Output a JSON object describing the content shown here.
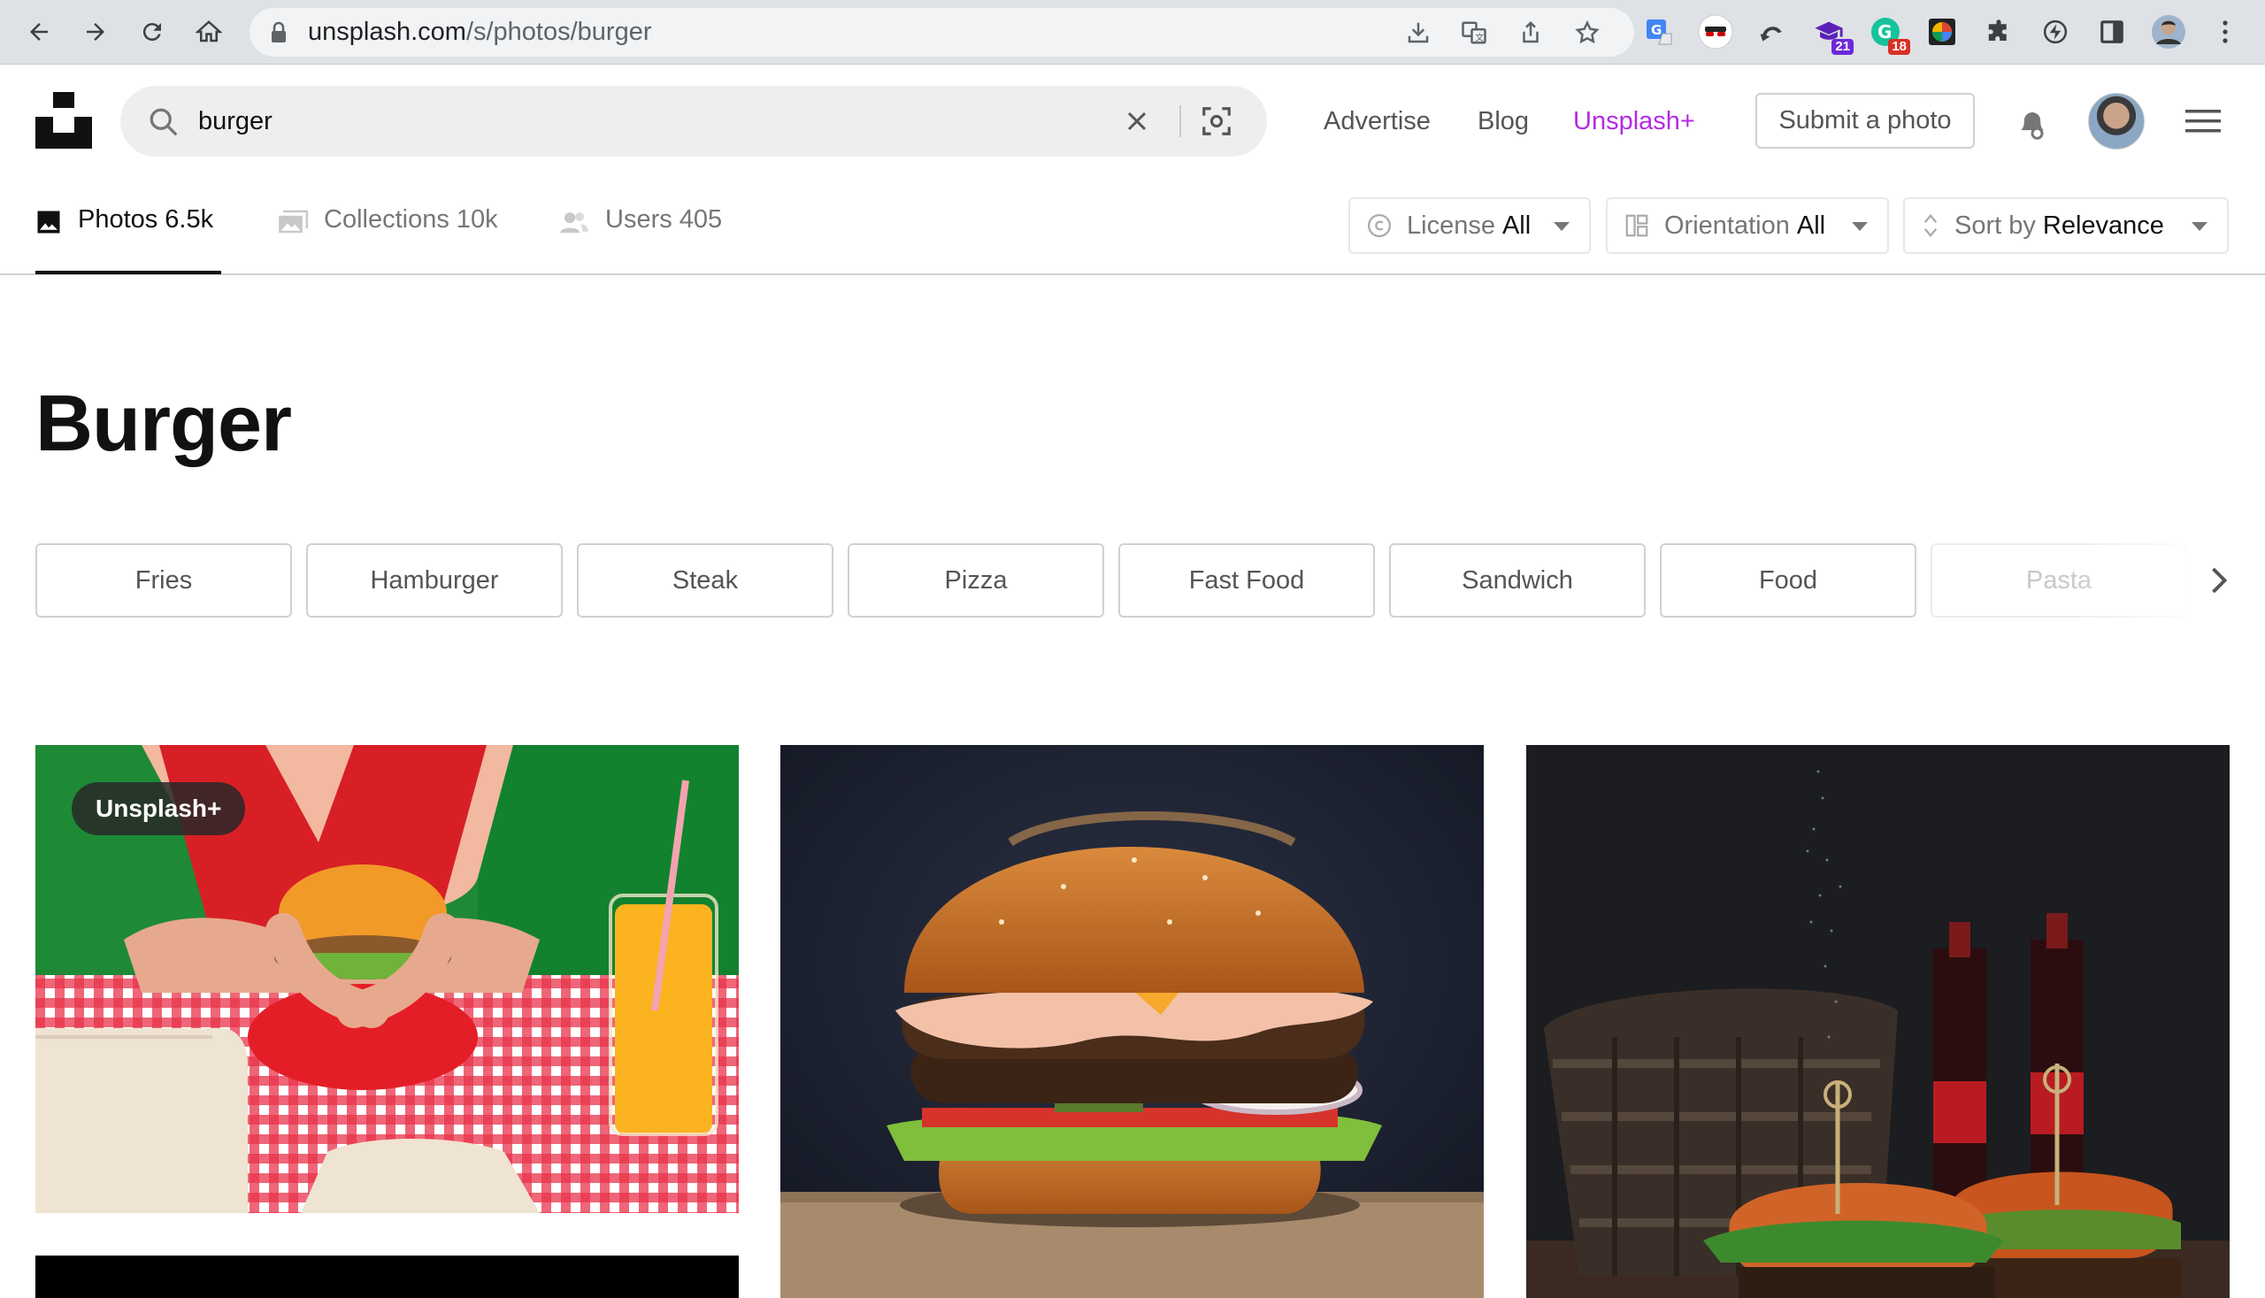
{
  "browser": {
    "url_host": "unsplash.com",
    "url_path": "/s/photos/burger",
    "extensions": [
      {
        "name": "translate-extension-icon",
        "badge": ""
      },
      {
        "name": "incognito-mask-icon",
        "badge": ""
      },
      {
        "name": "undo-arrow-extension-icon",
        "badge": ""
      },
      {
        "name": "graduation-cap-extension-icon",
        "badge": "21",
        "badge_color": "#6d28d9"
      },
      {
        "name": "grammarly-extension-icon",
        "badge": "18",
        "badge_color": "#d93025"
      },
      {
        "name": "color-wheel-extension-icon",
        "badge": ""
      },
      {
        "name": "puzzle-piece-icon",
        "badge": ""
      },
      {
        "name": "lightning-circle-icon",
        "badge": ""
      },
      {
        "name": "side-panel-icon",
        "badge": ""
      },
      {
        "name": "profile-avatar",
        "badge": ""
      }
    ]
  },
  "header": {
    "search_value": "burger",
    "links": {
      "advertise": "Advertise",
      "blog": "Blog",
      "unsplash_plus": "Unsplash+"
    },
    "submit_label": "Submit a photo",
    "plus_color": "#b32be3"
  },
  "tabs": [
    {
      "label": "Photos",
      "count": "6.5k",
      "active": true
    },
    {
      "label": "Collections",
      "count": "10k",
      "active": false
    },
    {
      "label": "Users",
      "count": "405",
      "active": false
    }
  ],
  "filters": [
    {
      "label": "License",
      "value": "All",
      "icon": "copyright-icon"
    },
    {
      "label": "Orientation",
      "value": "All",
      "icon": "orientation-icon"
    },
    {
      "label": "Sort by",
      "value": "Relevance",
      "icon": "sort-arrows-icon"
    }
  ],
  "page_title": "Burger",
  "related_chips": [
    "Fries",
    "Hamburger",
    "Steak",
    "Pizza",
    "Fast Food",
    "Sandwich",
    "Food",
    "Pasta"
  ],
  "photos": [
    {
      "badge": "Unsplash+"
    }
  ]
}
